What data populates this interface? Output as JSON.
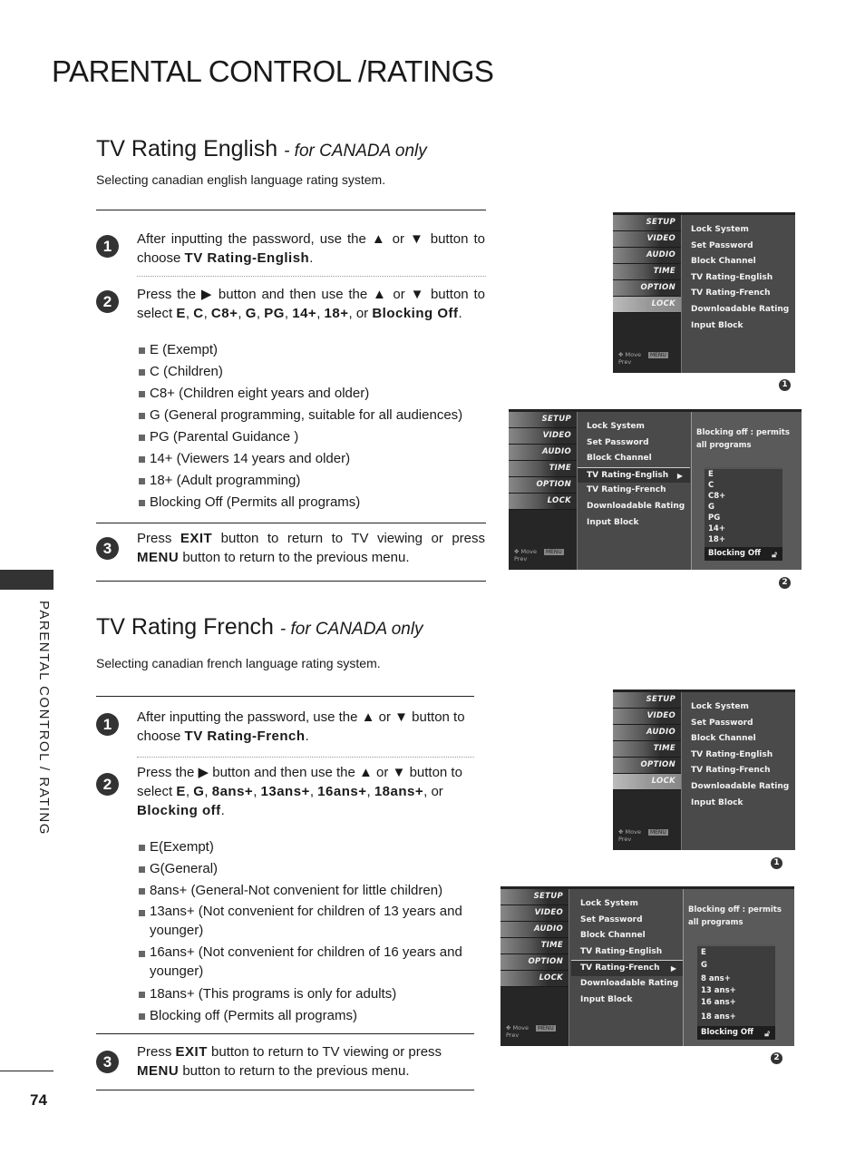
{
  "page": {
    "title": "PARENTAL CONTROL /RATINGS",
    "side_label": "PARENTAL CONTROL / RATING",
    "page_number": "74"
  },
  "english": {
    "title": "TV Rating English",
    "subtitle": "- for CANADA only",
    "description": "Selecting canadian english language rating system.",
    "steps": [
      {
        "num": "1",
        "parts": [
          "After inputting the password, use the ▲ or ▼ button to choose ",
          "TV Rating-English",
          "."
        ]
      },
      {
        "num": "2",
        "parts": [
          "Press the ▶ button and then use the ▲ or ▼ button to select ",
          "E",
          ", ",
          "C",
          ", ",
          "C8+",
          ", ",
          "G",
          ", ",
          "PG",
          ", ",
          "14+",
          ", ",
          "18+",
          ", or ",
          "Blocking Off",
          "."
        ]
      },
      {
        "num": "3",
        "parts": [
          "Press ",
          "EXIT",
          " button to return to TV viewing or press ",
          "MENU",
          " button to return to the previous menu."
        ]
      }
    ],
    "bullets": [
      "E (Exempt)",
      "C (Children)",
      "C8+ (Children eight years and older)",
      "G (General programming, suitable for all audiences)",
      "PG (Parental Guidance )",
      "14+ (Viewers 14 years and older)",
      "18+ (Adult programming)",
      "Blocking Off (Permits all programs)"
    ]
  },
  "french": {
    "title": "TV Rating French",
    "subtitle": "- for CANADA only",
    "description": "Selecting canadian french language rating system.",
    "steps": [
      {
        "num": "1",
        "parts": [
          "After inputting the password, use the ▲ or ▼ button to choose ",
          "TV Rating-French",
          "."
        ]
      },
      {
        "num": "2",
        "parts": [
          "Press the ▶ button and then use the ▲ or ▼ button to select ",
          "E",
          ", ",
          "G",
          ", ",
          "8ans+",
          ", ",
          "13ans+",
          ", ",
          "16ans+",
          ", ",
          "18ans+",
          ", or ",
          "Blocking off",
          "."
        ]
      },
      {
        "num": "3",
        "parts": [
          "Press ",
          "EXIT",
          " button to return to TV viewing or press ",
          "MENU",
          " button to return to the previous menu."
        ]
      }
    ],
    "bullets": [
      "E(Exempt)",
      "G(General)",
      "8ans+ (General-Not convenient for little children)",
      "13ans+ (Not convenient for children of 13 years and younger)",
      "16ans+ (Not convenient for children of 16 years and younger)",
      "18ans+ (This programs is only for adults)",
      "Blocking off (Permits all programs)"
    ]
  },
  "osd": {
    "tabs": [
      "SETUP",
      "VIDEO",
      "AUDIO",
      "TIME",
      "OPTION",
      "LOCK"
    ],
    "menu_items": [
      "Lock System",
      "Set Password",
      "Block Channel",
      "TV Rating-English",
      "TV Rating-French",
      "Downloadable Rating",
      "Input Block"
    ],
    "footer_move": "Move",
    "footer_prev": "Prev",
    "footer_prev_key": "MENU",
    "hint": "Blocking off : permits all programs",
    "english_options": [
      "E",
      "C",
      "C8+",
      "G",
      "PG",
      "14+",
      "18+"
    ],
    "french_options": [
      "E",
      "G",
      "8 ans+",
      "13 ans+",
      "16 ans+",
      "18 ans+"
    ],
    "blocking_label": "Blocking Off",
    "figure_labels": [
      "1",
      "2",
      "1",
      "2"
    ]
  }
}
